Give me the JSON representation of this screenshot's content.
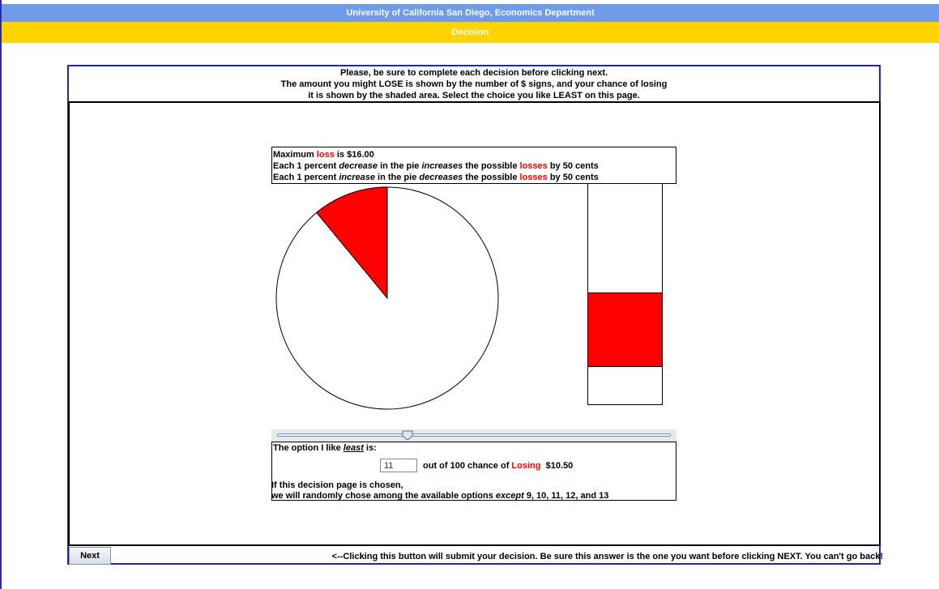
{
  "header": {
    "title": "University of California San Diego, Economics Department",
    "subtitle": "Decision"
  },
  "instructions": {
    "line1": "Please, be sure to complete each decision before clicking next.",
    "line2": "The amount you might LOSE is shown by the number of $ signs, and your chance of losing",
    "line3": "it is shown by the shaded area. Select the choice you like LEAST on this page."
  },
  "info": {
    "l1_a": "Maximum ",
    "l1_b": "loss",
    "l1_c": " is $16.00",
    "l2_a": "Each 1 percent ",
    "l2_b": "decrease",
    "l2_c": " in the pie ",
    "l2_d": "increases",
    "l2_e": " the possible ",
    "l2_f": "losses",
    "l2_g": " by 50 cents",
    "l3_a": "Each 1 percent ",
    "l3_b": "increase",
    "l3_c": " in the pie ",
    "l3_d": "decreases",
    "l3_e": " the possible ",
    "l3_f": "losses",
    "l3_g": " by 50 cents"
  },
  "pie": {
    "loss_chance_percent": 11,
    "shade_color": "#ff0000"
  },
  "loss_bar": {
    "loss": 10.5,
    "max_loss": 16.0,
    "shade_color": "#ff0000"
  },
  "slider": {
    "value_percent": 11
  },
  "option": {
    "label_a": "The option I like ",
    "label_b": "least",
    "label_c": " is:",
    "value": "11",
    "text_a": "out of 100 chance of ",
    "text_b": "Losing",
    "text_c": "  $10.50",
    "chosen_line1": "If this decision page is chosen,",
    "chosen_line2_a": "we will randomly chose among the available options ",
    "chosen_line2_b": "except",
    "chosen_line2_c": " 9, 10, 11, 12, and 13"
  },
  "footer": {
    "next_label": "Next",
    "note": "<--Clicking this button will submit your decision.  Be sure this answer is the one you want before clicking NEXT.  You can't go back!"
  }
}
